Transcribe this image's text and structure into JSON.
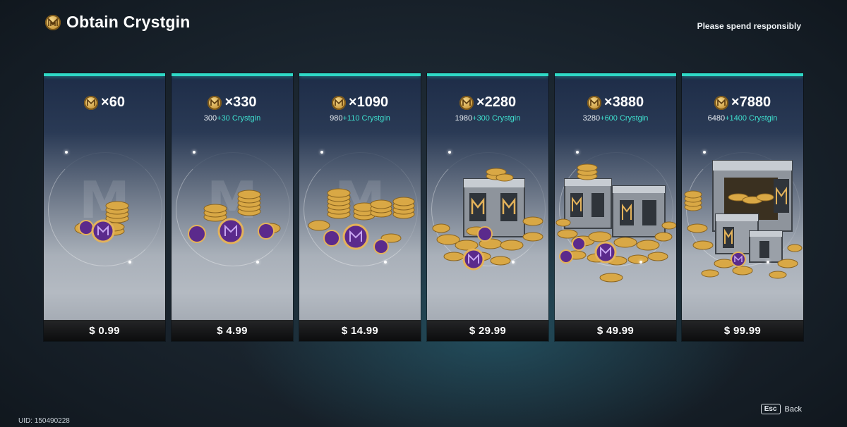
{
  "header": {
    "title": "Obtain Crystgin",
    "currency_icon": "crystgin-coin-icon",
    "notice": "Please spend responsibly"
  },
  "packages": [
    {
      "amount": "×60",
      "base": "",
      "extra": "",
      "suffix": "",
      "price": "$ 0.99",
      "pile": "small"
    },
    {
      "amount": "×330",
      "base": "300",
      "extra": "+30",
      "suffix": " Crystgin",
      "price": "$ 4.99",
      "pile": "medium"
    },
    {
      "amount": "×1090",
      "base": "980",
      "extra": "+110",
      "suffix": " Crystgin",
      "price": "$ 14.99",
      "pile": "large"
    },
    {
      "amount": "×2280",
      "base": "1980",
      "extra": "+300",
      "suffix": " Crystgin",
      "price": "$ 29.99",
      "pile": "box"
    },
    {
      "amount": "×3880",
      "base": "3280",
      "extra": "+600",
      "suffix": " Crystgin",
      "price": "$ 49.99",
      "pile": "boxes"
    },
    {
      "amount": "×7880",
      "base": "6480",
      "extra": "+1400",
      "suffix": " Crystgin",
      "price": "$ 99.99",
      "pile": "vault"
    }
  ],
  "footer": {
    "uid": "UID: 150490228",
    "esc_key": "Esc",
    "back_label": "Back"
  },
  "colors": {
    "accent": "#2fd9c6",
    "bonus": "#3fe0cf",
    "coin_gold": "#d9a845",
    "coin_purple": "#5b2a8c"
  }
}
